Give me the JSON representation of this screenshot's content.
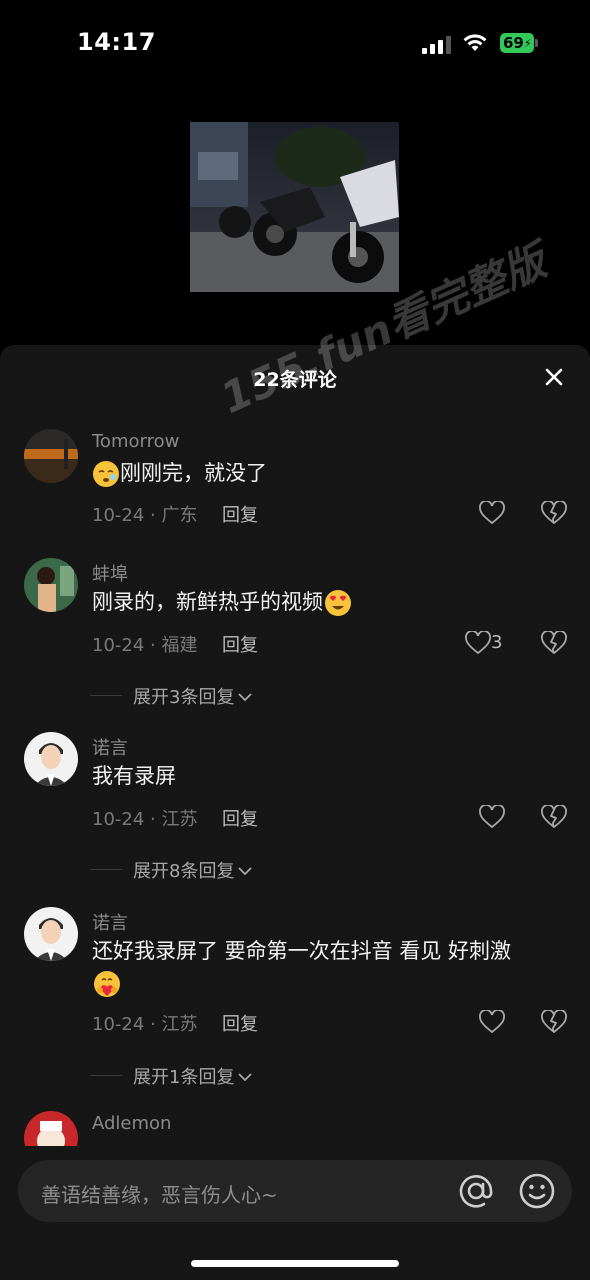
{
  "status_bar": {
    "time": "14:17",
    "battery": "69"
  },
  "comments_sheet": {
    "title": "22条评论",
    "watermark": "155.fun看完整版",
    "comments": [
      {
        "user": "Tomorrow",
        "text": "刚刚完，就没了",
        "emoji": "sleepy-face-emoji",
        "date_location": "10-24 · 广东",
        "reply_label": "回复"
      },
      {
        "user": "蚌埠",
        "text": "刚录的，新鲜热乎的视频",
        "emoji": "heart-eyes-emoji",
        "date_location": "10-24 · 福建",
        "reply_label": "回复",
        "likes": "3",
        "expand_label": "展开3条回复"
      },
      {
        "user": "诺言",
        "text": "我有录屏",
        "date_location": "10-24 · 江苏",
        "reply_label": "回复",
        "expand_label": "展开8条回复"
      },
      {
        "user": "诺言",
        "text": "还好我录屏了 要命第一次在抖音 看见 好刺激",
        "emoji": "heart-hug-emoji",
        "date_location": "10-24 · 江苏",
        "reply_label": "回复",
        "expand_label": "展开1条回复"
      },
      {
        "user": "Adlemon"
      }
    ]
  },
  "input_bar": {
    "placeholder": "善语结善缘，恶言伤人心~"
  },
  "colors": {
    "sheet_bg": "#161616",
    "input_bg": "#252525",
    "battery_green": "#34c759"
  }
}
